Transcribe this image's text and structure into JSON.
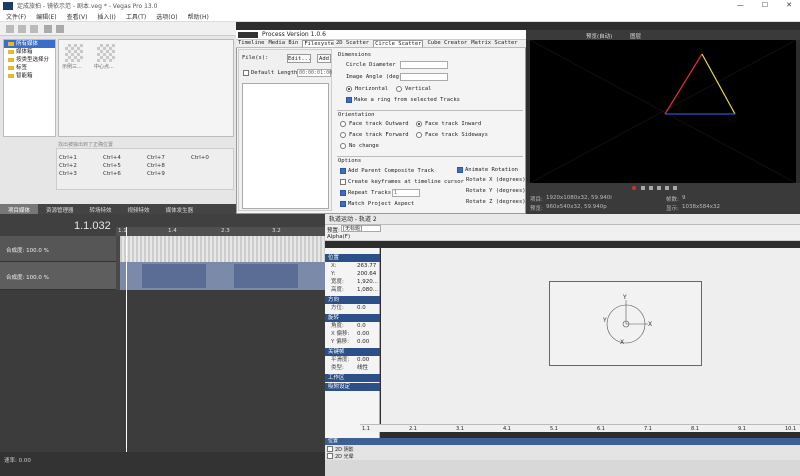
{
  "window": {
    "title": "定成旅拍 - 镜依示范 - 剧本.veg * - Vegas Pro 13.0",
    "controls": [
      "—",
      "☐",
      "✕"
    ]
  },
  "menu": [
    "文件(F)",
    "编辑(E)",
    "查看(V)",
    "插入(I)",
    "工具(T)",
    "选项(O)",
    "帮助(H)"
  ],
  "explorer": {
    "tree": [
      "所有媒体",
      "媒体箱",
      "按类型选择分",
      "标签",
      "智能箱"
    ],
    "thumbs": [
      {
        "label": "示例三..."
      },
      {
        "label": "中心点..."
      }
    ],
    "shortcuts_header": "找出被输出到了正确位置",
    "shortcuts": [
      [
        "Ctrl+1",
        "Ctrl+4",
        "Ctrl+7",
        "Ctrl+0"
      ],
      [
        "Ctrl+2",
        "Ctrl+5",
        "Ctrl+8",
        ""
      ],
      [
        "Ctrl+3",
        "Ctrl+6",
        "Ctrl+9",
        ""
      ]
    ],
    "tabs": [
      "项目媒体",
      "资源管理器",
      "转场特效",
      "视频特效",
      "媒体发生器"
    ]
  },
  "process": {
    "title": "Process  Version 1.0.6",
    "left_tabs": [
      "Timeline",
      "Media Bin",
      "Filesystem"
    ],
    "right_tabs": [
      "2D Scatter",
      "Circle Scatter",
      "Cube Creator",
      "Matrix Scatter"
    ],
    "files_label": "File(s):",
    "edit_btn": "Edit...",
    "add_btn": "Add",
    "default_length_label": "Default Length:",
    "default_length_value": "00:00:01:00",
    "dimensions": {
      "header": "Dimensions",
      "circle_diameter_label": "Circle Diameter (pixels):",
      "image_angle_label": "Image Angle (degrees):",
      "horizontal": "Horizontal",
      "vertical": "Vertical",
      "make_ring": "Make a ring from selected Tracks"
    },
    "orientation": {
      "header": "Orientation",
      "face_outward": "Face track Outward",
      "face_inward": "Face track Inward",
      "face_forward": "Face track Forward",
      "face_sideways": "Face track Sideways",
      "no_change": "No change"
    },
    "options": {
      "header": "Options",
      "add_parent": "Add Parent Composite Track",
      "animate_rotation": "Animate Rotation",
      "create_keyframes": "Create keyframes at timeline cursor",
      "rotate_x": "Rotate X (degrees):",
      "repeat_tracks": "Repeat Tracks",
      "repeat_value": "1",
      "rotate_y": "Rotate Y (degrees):",
      "match_aspect": "Match Project Aspect",
      "rotate_z": "Rotate Z (degrees):"
    }
  },
  "preview": {
    "quality": "预览(自动)",
    "view": "图层",
    "project_label": "项目:",
    "project_value": "1920x1080x32, 59.940i",
    "preview_label": "预览:",
    "preview_value": "960x540x32, 59.940p",
    "frame_label": "帧数:",
    "frame_value": "9",
    "display_label": "显示:",
    "display_value": "1038x584x32",
    "colors": {
      "red": "#e03030",
      "yellow": "#e8e030",
      "blue": "#3050d0"
    }
  },
  "timeline": {
    "timecode": "1.1.032",
    "ruler": [
      "1.1",
      "1.4",
      "2.3",
      "3.2"
    ],
    "tracks": [
      {
        "label": "合成度: 100.0 %"
      },
      {
        "label": "合成度: 100.0 %"
      }
    ],
    "rate_label": "速率: 0.00"
  },
  "pan": {
    "title": "轨道运动 - 轨道 2",
    "preset_label": "预置:",
    "preset_value": "[无标题]",
    "alpha_label": "Alpha(F)",
    "sections": {
      "position": "位置",
      "direction": "方向",
      "rotation": "旋转",
      "keyframe": "关键帧",
      "workspace": "工作区",
      "snap": "吸附设定"
    },
    "position_rows": [
      {
        "k": "X:",
        "v": "263.77"
      },
      {
        "k": "Y:",
        "v": "200.64"
      },
      {
        "k": "宽度:",
        "v": "1,920..."
      },
      {
        "k": "高度:",
        "v": "1,080..."
      }
    ],
    "direction_rows": [
      {
        "k": "方位:",
        "v": "0.0"
      }
    ],
    "rotation_rows": [
      {
        "k": "角度:",
        "v": "0.0"
      },
      {
        "k": "X 偏移:",
        "v": "0.00"
      },
      {
        "k": "Y 偏移:",
        "v": "0.00"
      }
    ],
    "keyframe_rows": [
      {
        "k": "平滑度:",
        "v": "0.00"
      },
      {
        "k": "类型:",
        "v": "线性"
      }
    ],
    "ruler": [
      "1.1",
      "2.1",
      "3.1",
      "4.1",
      "5.1",
      "6.1",
      "7.1",
      "8.1",
      "9.1",
      "10.1"
    ],
    "bottom_tracks": [
      {
        "label": "位置"
      },
      {
        "label": "2D 阴影"
      },
      {
        "label": "2D 光晕"
      }
    ],
    "axis_x": "X",
    "axis_y": "Y"
  }
}
